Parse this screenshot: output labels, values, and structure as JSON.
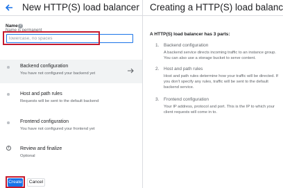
{
  "left_panel": {
    "title": "New HTTP(S) load balancer",
    "name_field": {
      "label": "Name",
      "help_icon": "help-icon",
      "hint": "Name is permanent",
      "placeholder": "lowercase, no spaces",
      "value": ""
    },
    "steps": [
      {
        "title": "Backend configuration",
        "subtitle": "You have not configured your backend yet",
        "icon": "bullet-dot-icon"
      },
      {
        "title": "Host and path rules",
        "subtitle": "Requests will be sent to the default backend",
        "icon": "bullet-dot-icon"
      },
      {
        "title": "Frontend configuration",
        "subtitle": "You have not configured your frontend yet",
        "icon": "bullet-dot-icon"
      },
      {
        "title": "Review and finalize",
        "subtitle": "Optional",
        "icon": "info-icon"
      }
    ],
    "create_label": "Create",
    "cancel_label": "Cancel"
  },
  "right_panel": {
    "title": "Creating a HTTP(S) load balancer",
    "intro": "A HTTP(S) load balancer has 3 parts:",
    "parts": [
      {
        "num": "1.",
        "title": "Backend configuration",
        "desc": "A backend service directs incoming traffic to an instance group. You can also use a storage bucket to serve content."
      },
      {
        "num": "2.",
        "title": "Host and path rules",
        "desc": "Host and path rules determine how your traffic will be directed. If you don't specify any rules, traffic will be sent to the default backend service."
      },
      {
        "num": "3.",
        "title": "Frontend configuration",
        "desc": "Your IP address, protocol and port. This is the IP to which your client requests will come in to."
      }
    ]
  },
  "colors": {
    "accent": "#1a73e8",
    "highlight": "#c5192d",
    "active_step_bg": "#f1f3f4"
  }
}
